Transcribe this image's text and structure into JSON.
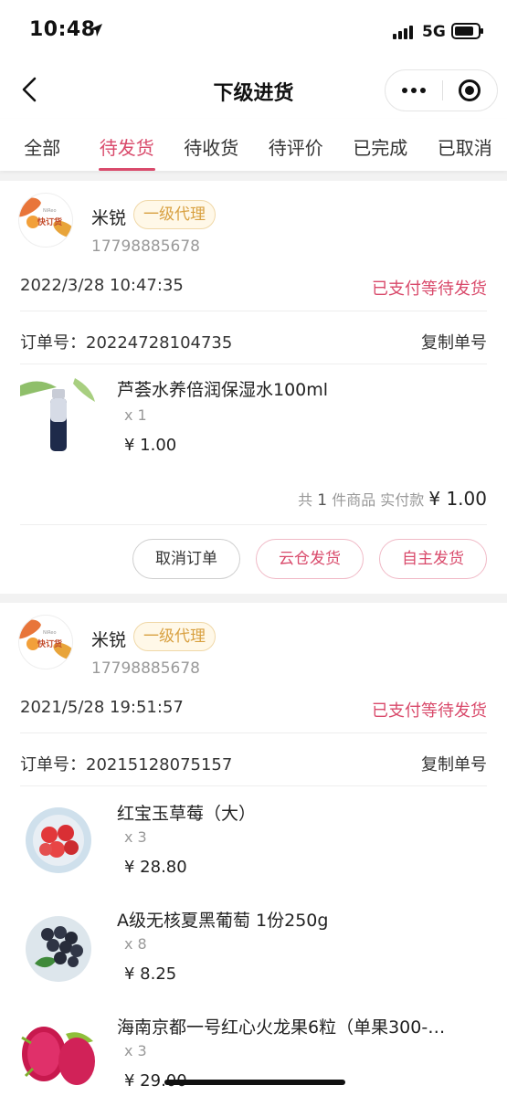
{
  "status_bar": {
    "time": "10:48",
    "network": "5G"
  },
  "nav": {
    "title": "下级进货"
  },
  "tabs": [
    {
      "label": "全部",
      "active": false
    },
    {
      "label": "待发货",
      "active": true
    },
    {
      "label": "待收货",
      "active": false
    },
    {
      "label": "待评价",
      "active": false
    },
    {
      "label": "已完成",
      "active": false
    },
    {
      "label": "已取消",
      "active": false
    }
  ],
  "orders": [
    {
      "shop_name": "米锐",
      "level": "一级代理",
      "phone": "17798885678",
      "time": "2022/3/28 10:47:35",
      "status": "已支付等待发货",
      "order_no_label": "订单号：",
      "order_no": "20224728104735",
      "copy_label": "复制单号",
      "items": [
        {
          "name": "芦荟水养倍润保湿水100ml",
          "qty": "x 1",
          "price": "¥ 1.00"
        }
      ],
      "summary": {
        "prefix": "共",
        "count": "1",
        "middle": "件商品  实付款",
        "total": "¥ 1.00"
      },
      "buttons": {
        "cancel": "取消订单",
        "cloud": "云仓发货",
        "self": "自主发货"
      }
    },
    {
      "shop_name": "米锐",
      "level": "一级代理",
      "phone": "17798885678",
      "time": "2021/5/28 19:51:57",
      "status": "已支付等待发货",
      "order_no_label": "订单号：",
      "order_no": "20215128075157",
      "copy_label": "复制单号",
      "items": [
        {
          "name": "红宝玉草莓（大）",
          "qty": "x 3",
          "price": "¥ 28.80"
        },
        {
          "name": "A级无核夏黑葡萄 1份250g",
          "qty": "x 8",
          "price": "¥ 8.25"
        },
        {
          "name": "海南京都一号红心火龙果6粒（单果300-…",
          "qty": "x 3",
          "price": "¥ 29.00"
        }
      ]
    }
  ],
  "logo": {
    "brand": "快订货",
    "brand_en": "NiReo"
  },
  "colors": {
    "accent": "#d94a6b",
    "badge_text": "#d8a040",
    "badge_bg": "#fff8e8"
  }
}
